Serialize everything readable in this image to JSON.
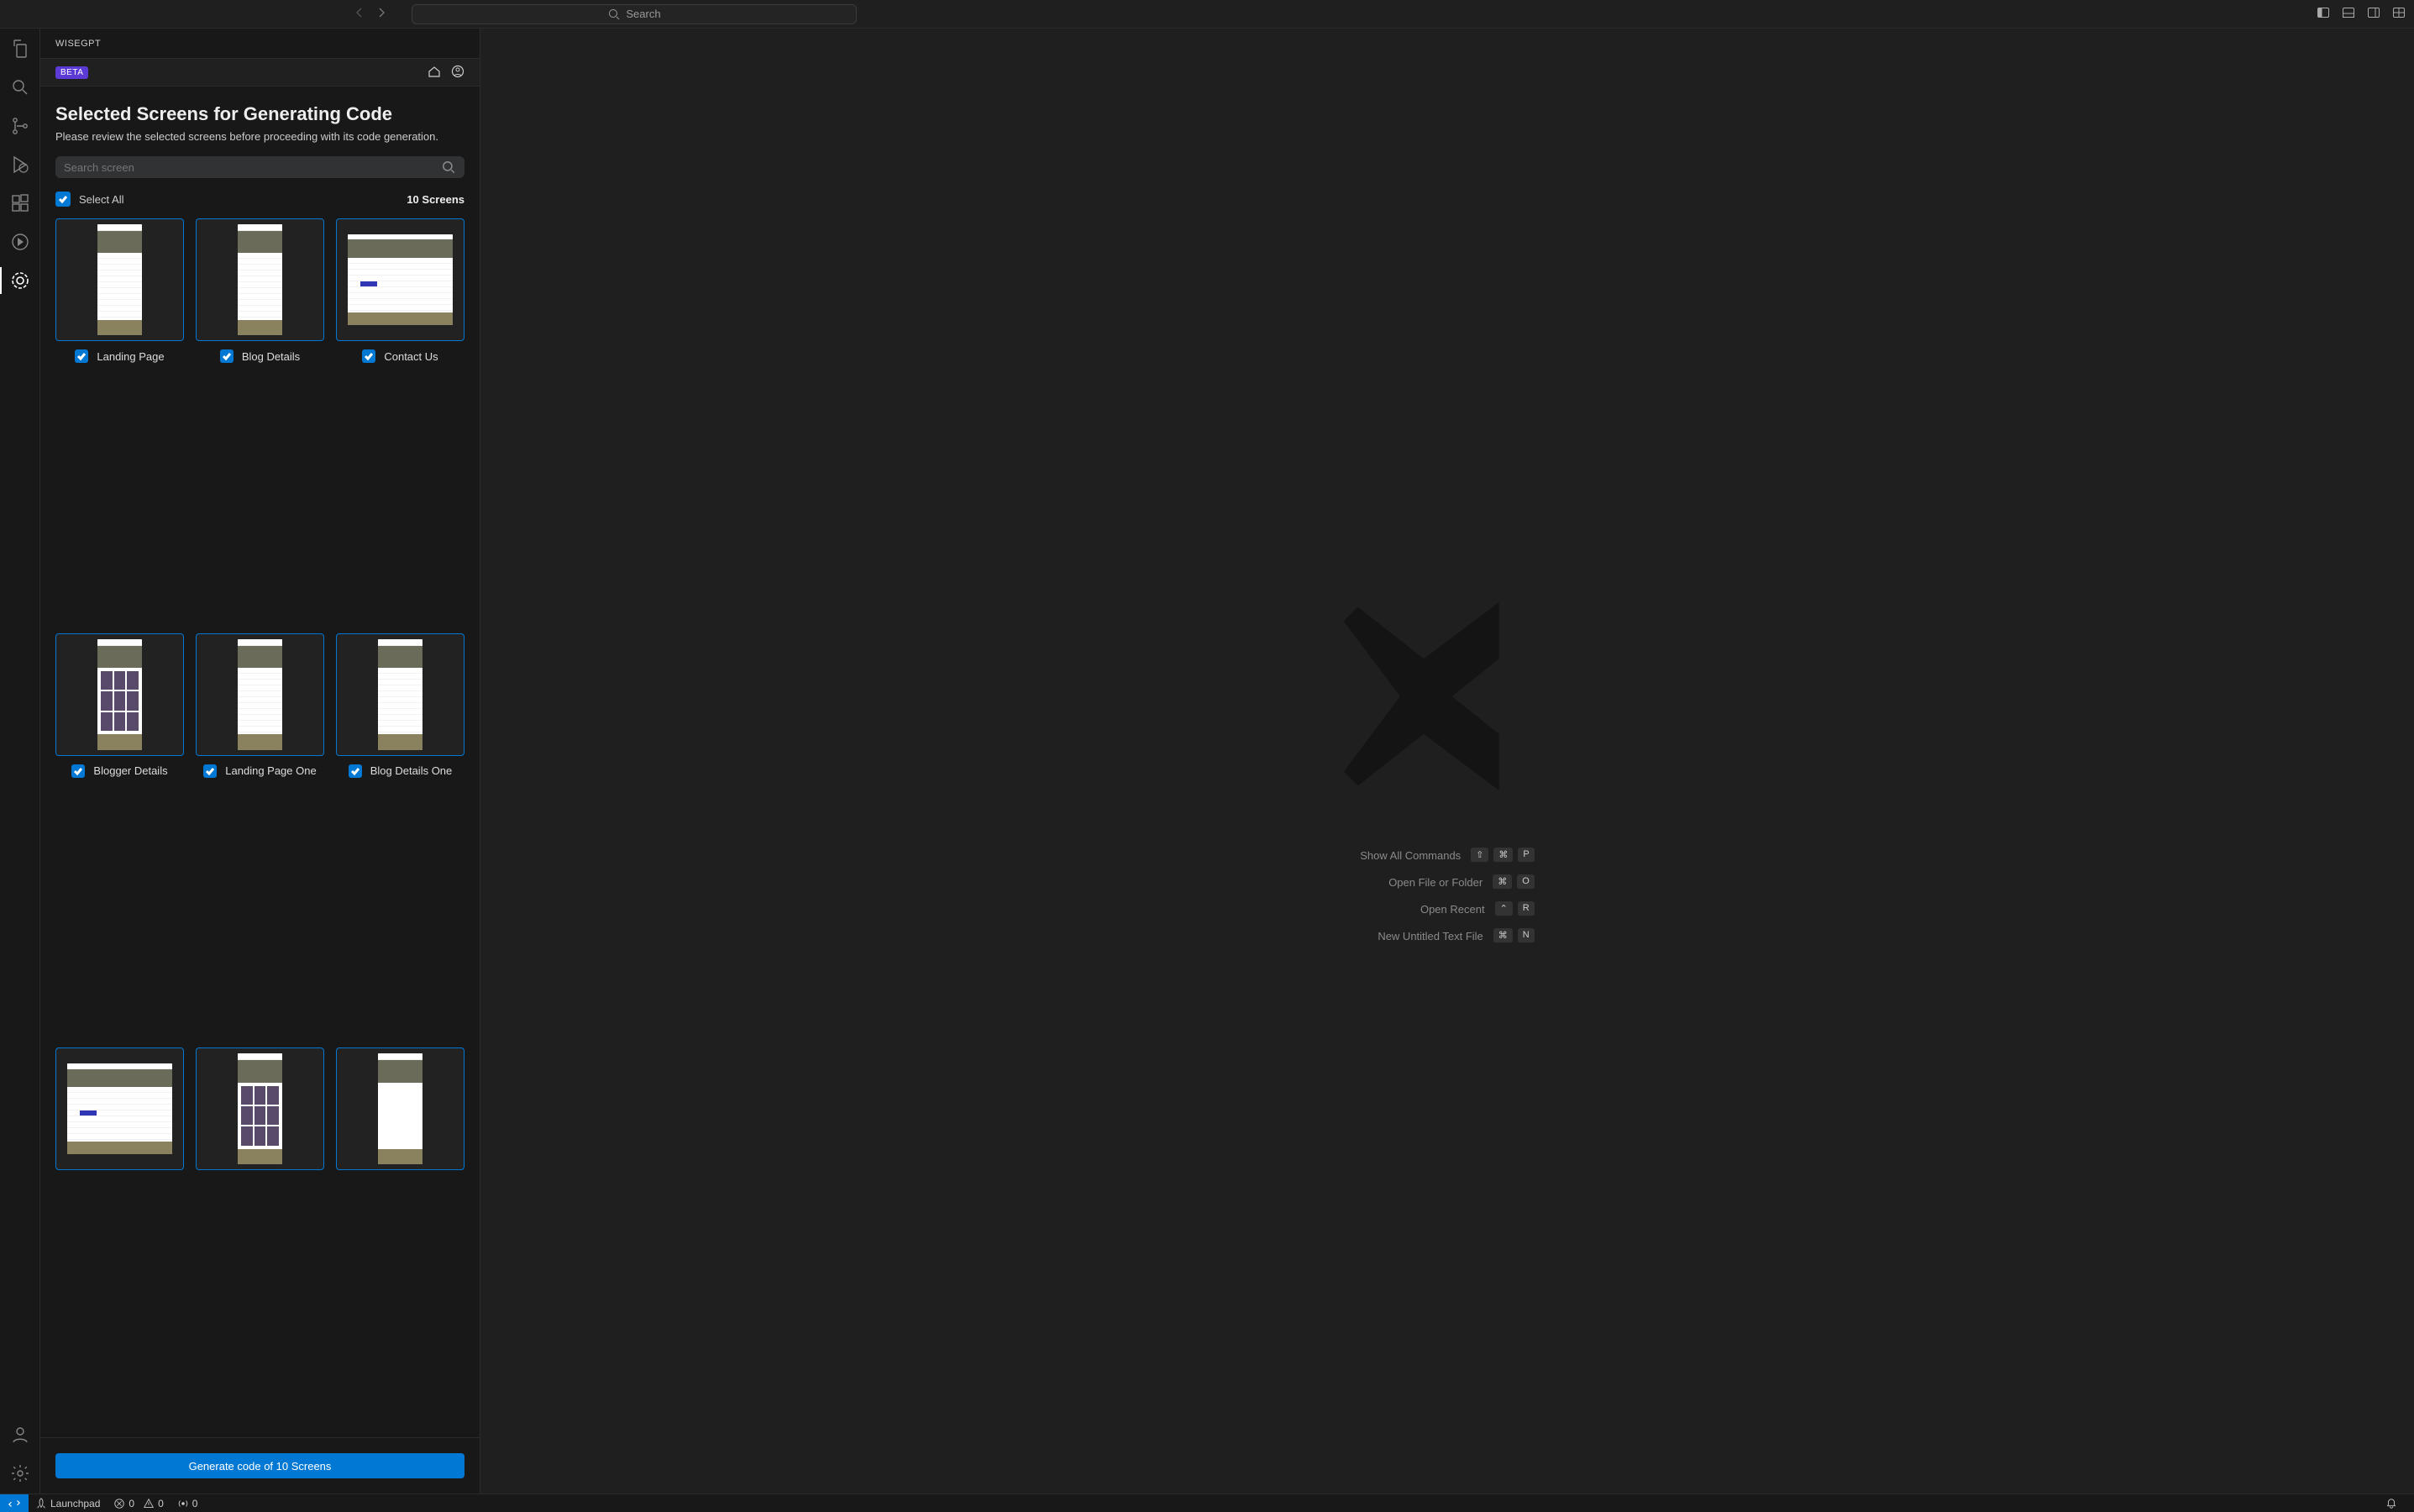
{
  "titlebar": {
    "search_placeholder": "Search"
  },
  "sidebar": {
    "title": "WISEGPT",
    "beta_label": "BETA",
    "heading": "Selected Screens for Generating Code",
    "subheading": "Please review the selected screens before proceeding with its code generation.",
    "search_placeholder": "Search screen",
    "select_all_label": "Select All",
    "screens_count_label": "10 Screens",
    "screens": [
      {
        "name": "Landing Page",
        "preview": "narrow"
      },
      {
        "name": "Blog Details",
        "preview": "narrow"
      },
      {
        "name": "Contact Us",
        "preview": "wide"
      },
      {
        "name": "Blogger Details",
        "preview": "grid"
      },
      {
        "name": "Landing Page One",
        "preview": "narrow"
      },
      {
        "name": "Blog Details One",
        "preview": "narrow"
      },
      {
        "name": "",
        "preview": "wide"
      },
      {
        "name": "",
        "preview": "grid"
      },
      {
        "name": "",
        "preview": "list"
      }
    ],
    "generate_button": "Generate code of 10 Screens"
  },
  "welcome": {
    "shortcuts": [
      {
        "label": "Show All Commands",
        "keys": [
          "⇧",
          "⌘",
          "P"
        ]
      },
      {
        "label": "Open File or Folder",
        "keys": [
          "⌘",
          "O"
        ]
      },
      {
        "label": "Open Recent",
        "keys": [
          "⌃",
          "R"
        ]
      },
      {
        "label": "New Untitled Text File",
        "keys": [
          "⌘",
          "N"
        ]
      }
    ]
  },
  "statusbar": {
    "launchpad": "Launchpad",
    "errors": "0",
    "warnings": "0",
    "ports": "0"
  }
}
